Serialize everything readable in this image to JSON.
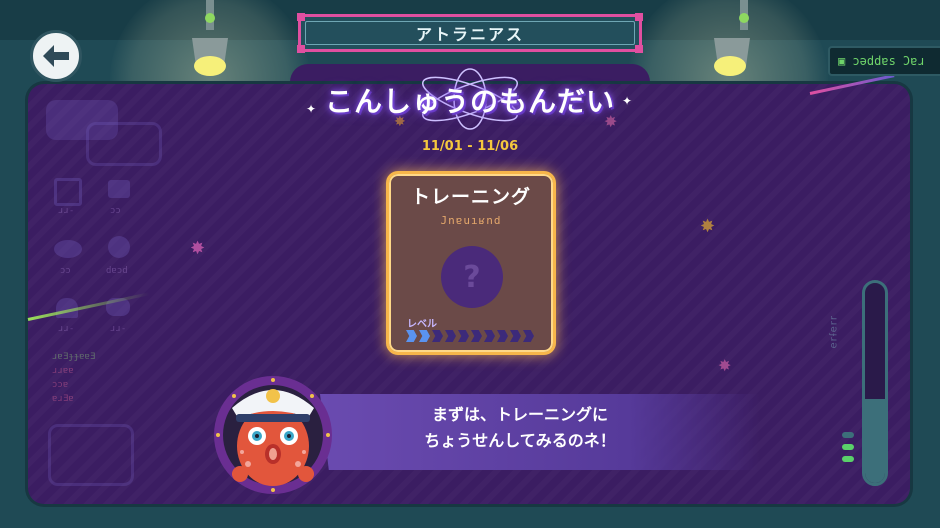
{
  "header": {
    "back_button_icon": "back-arrow-icon",
    "title": "アトラニアス",
    "ticker_text": "▣ ɔǝddɐs Ɔɐɹ"
  },
  "main": {
    "heading": "こんしゅうのもんだい",
    "date_range": "11/01 - 11/06",
    "card": {
      "title": "トレーニング",
      "subtitle": "Jnɐuıʁnd",
      "mystery_icon": "question-mark-icon",
      "level_label": "レベル",
      "level_filled": 2,
      "level_total": 10
    }
  },
  "dialog": {
    "line1": "まずは、トレーニングに",
    "line2": "ちょうせんしてみるのネ！",
    "speaker_icon": "octopus-captain-icon"
  },
  "left_panel_ghost": {
    "item_labels": [
      "ɹɹ-",
      "ɔɔ",
      "ɔɔ",
      "dɐɔd",
      "ɹɹ-",
      "ɹɹ-"
    ],
    "list_lines": [
      "ɹɐƎɟɟɐɐƎ",
      "ɹɹɐɐ",
      "ɔɔɐ",
      "ɐɹƎɐ"
    ]
  },
  "gauge": {
    "label": "ɹɹǝɟɹǝ",
    "fill_fraction": 0.42
  },
  "colors": {
    "panel": "#3b1d62",
    "accent_pink": "#e04fa0",
    "card_border": "#f7b64a",
    "date": "#f5c73d"
  }
}
